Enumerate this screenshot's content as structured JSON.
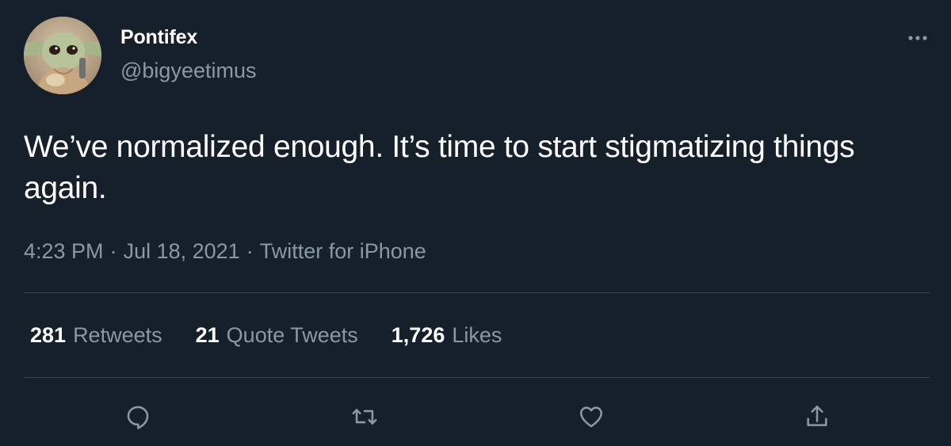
{
  "author": {
    "display_name": "Pontifex",
    "handle": "@bigyeetimus",
    "avatar_icon": "baby-yoda-avatar"
  },
  "tweet": {
    "text": "We’ve normalized enough. It’s time to start stigmatizing things again."
  },
  "meta": {
    "time": "4:23 PM",
    "separator": "·",
    "date": "Jul 18, 2021",
    "source": "Twitter for iPhone"
  },
  "stats": {
    "retweets_count": "281",
    "retweets_label": "Retweets",
    "quotes_count": "21",
    "quotes_label": "Quote Tweets",
    "likes_count": "1,726",
    "likes_label": "Likes"
  },
  "icons": {
    "more": "more-icon",
    "reply": "reply-icon",
    "retweet": "retweet-icon",
    "like": "like-icon",
    "share": "share-icon"
  },
  "colors": {
    "background": "#15202b",
    "text_primary": "#ffffff",
    "text_secondary": "#8899a6",
    "divider": "#38444d"
  }
}
